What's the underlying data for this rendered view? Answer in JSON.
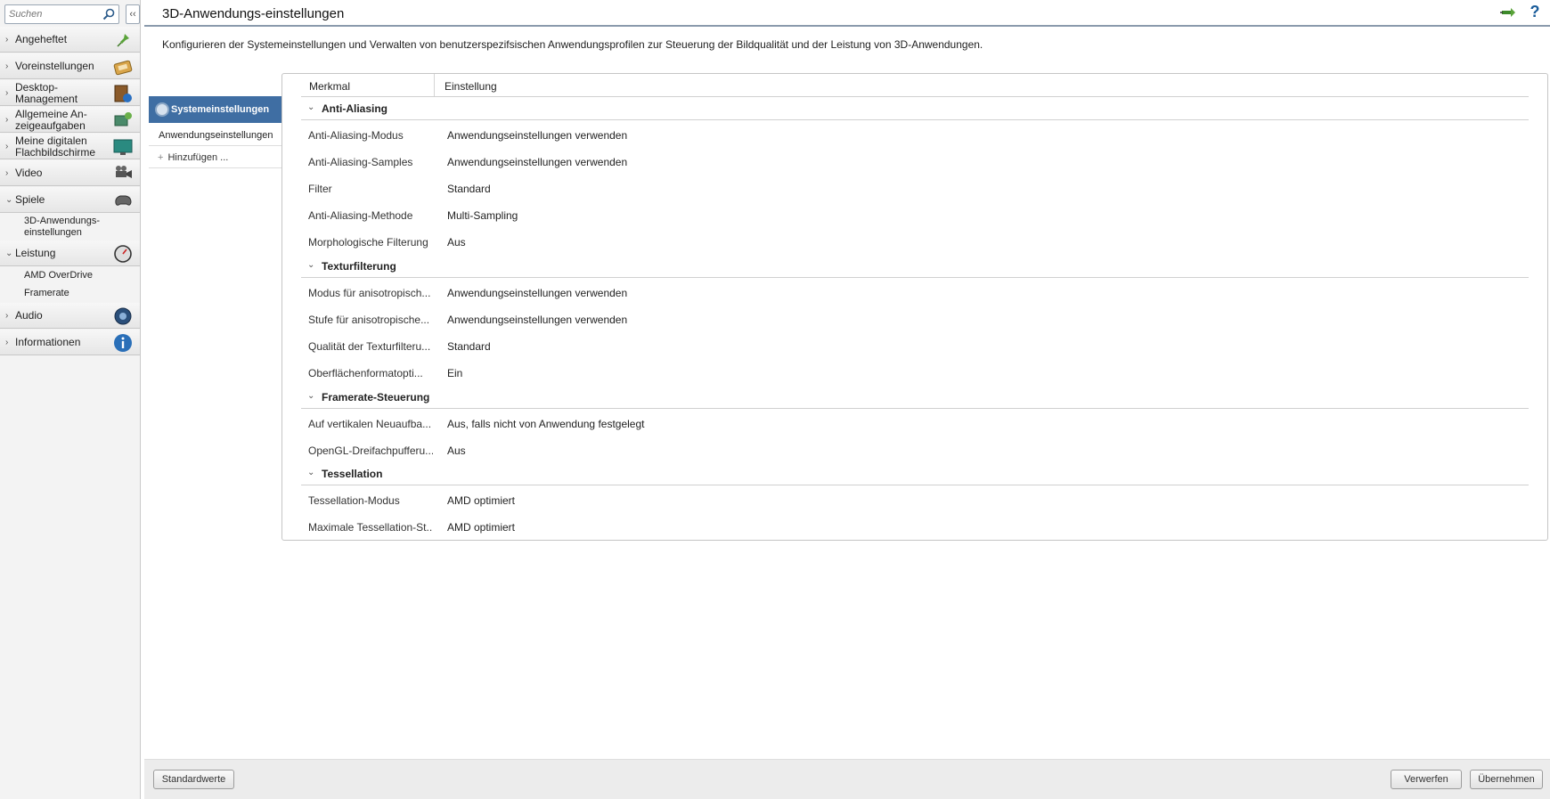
{
  "search": {
    "placeholder": "Suchen"
  },
  "sidebar": {
    "collapse_label": "‹‹",
    "items": [
      {
        "label": "Angeheftet",
        "icon": "pin-icon"
      },
      {
        "label": "Voreinstellungen",
        "icon": "presets-icon"
      },
      {
        "label": "Desktop-Management",
        "icon": "desktop-icon"
      },
      {
        "label": "Allgemeine An-zeigeaufgaben",
        "icon": "display-tasks-icon"
      },
      {
        "label": "Meine digitalen Flachbildschirme",
        "icon": "monitor-icon"
      },
      {
        "label": "Video",
        "icon": "video-camera-icon"
      },
      {
        "label": "Spiele",
        "icon": "gamepad-icon"
      },
      {
        "label": "Leistung",
        "icon": "gauge-icon"
      },
      {
        "label": "Audio",
        "icon": "speaker-icon"
      },
      {
        "label": "Informationen",
        "icon": "info-icon"
      }
    ],
    "spiele_sub": [
      "3D-Anwendungs-einstellungen"
    ],
    "leistung_sub": [
      "AMD OverDrive",
      "Framerate"
    ]
  },
  "header": {
    "title": "3D-Anwendungs-einstellungen",
    "help": "?"
  },
  "description": "Konfigurieren der Systemeinstellungen und Verwalten von benutzerspezifsischen Anwendungsprofilen zur Steuerung der Bildqualität und der Leistung von 3D-Anwendungen.",
  "tabs": {
    "system": "Systemeinstellungen",
    "app": "Anwendungseinstellungen",
    "add": "Hinzufügen ..."
  },
  "table": {
    "col_feature": "Merkmal",
    "col_setting": "Einstellung",
    "sections": [
      {
        "title": "Anti-Aliasing",
        "rows": [
          {
            "name": "Anti-Aliasing-Modus",
            "value": "Anwendungseinstellungen verwenden"
          },
          {
            "name": "Anti-Aliasing-Samples",
            "value": "Anwendungseinstellungen verwenden"
          },
          {
            "name": "Filter",
            "value": "Standard"
          },
          {
            "name": "Anti-Aliasing-Methode",
            "value": "Multi-Sampling"
          },
          {
            "name": "Morphologische Filterung",
            "value": "Aus"
          }
        ]
      },
      {
        "title": "Texturfilterung",
        "rows": [
          {
            "name": "Modus für anisotropisch...",
            "value": "Anwendungseinstellungen verwenden"
          },
          {
            "name": "Stufe für anisotropische...",
            "value": "Anwendungseinstellungen verwenden"
          },
          {
            "name": "Qualität der Texturfilteru...",
            "value": "Standard"
          },
          {
            "name": "Oberflächenformatopti...",
            "value": "Ein"
          }
        ]
      },
      {
        "title": "Framerate-Steuerung",
        "rows": [
          {
            "name": "Auf vertikalen Neuaufba...",
            "value": "Aus, falls nicht von Anwendung festgelegt"
          },
          {
            "name": "OpenGL-Dreifachpufferu...",
            "value": "Aus"
          }
        ]
      },
      {
        "title": "Tessellation",
        "rows": [
          {
            "name": "Tessellation-Modus",
            "value": "AMD optimiert"
          },
          {
            "name": "Maximale Tessellation-St...",
            "value": "AMD optimiert"
          }
        ]
      }
    ]
  },
  "footer": {
    "defaults": "Standardwerte",
    "discard": "Verwerfen",
    "apply": "Übernehmen"
  }
}
